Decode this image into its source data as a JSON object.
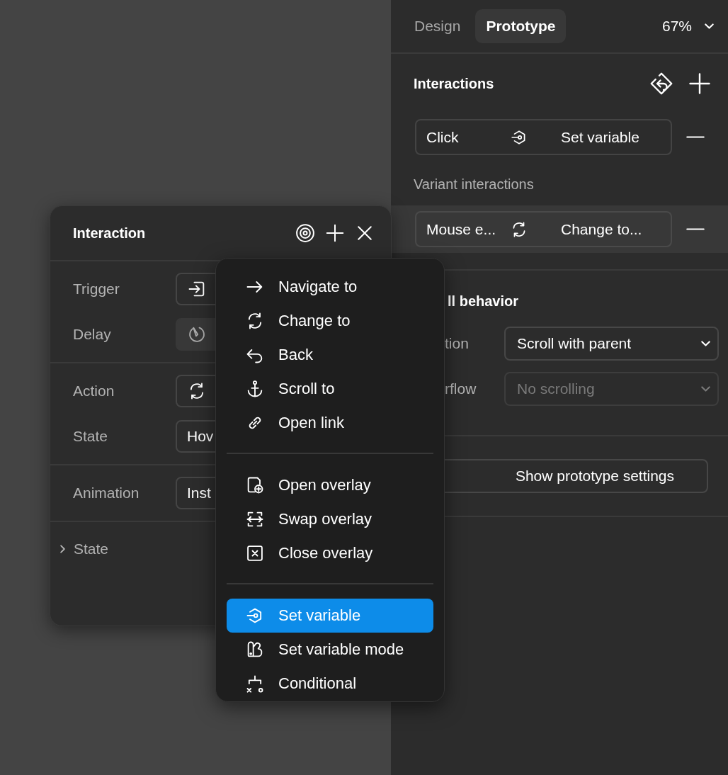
{
  "right_panel": {
    "tabs": [
      {
        "label": "Design",
        "selected": false
      },
      {
        "label": "Prototype",
        "selected": true
      }
    ],
    "zoom": "67%",
    "interactions": {
      "title": "Interactions",
      "rows": [
        {
          "trigger": "Click",
          "action": "Set variable",
          "highlighted": false
        }
      ],
      "variant_title": "Variant interactions",
      "variant_rows": [
        {
          "trigger": "Mouse e...",
          "action": "Change to...",
          "highlighted": true
        }
      ]
    },
    "scroll_behavior": {
      "title": "ll behavior",
      "rows": [
        {
          "label": "tion",
          "value": "Scroll with parent",
          "disabled": false
        },
        {
          "label": "rflow",
          "value": "No scrolling",
          "disabled": true
        }
      ]
    },
    "settings_button": "Show prototype settings"
  },
  "interaction_popup": {
    "title": "Interaction",
    "sections": [
      [
        {
          "label": "Trigger",
          "kind": "select"
        },
        {
          "label": "Delay",
          "kind": "filled"
        }
      ],
      [
        {
          "label": "Action",
          "kind": "select"
        },
        {
          "label": "State",
          "kind": "select",
          "value": "Hov"
        }
      ],
      [
        {
          "label": "Animation",
          "kind": "select",
          "value": "Inst"
        }
      ]
    ],
    "footer": {
      "label": "State",
      "expanded": false
    }
  },
  "action_menu": {
    "groups": [
      [
        {
          "label": "Navigate to",
          "selected": false
        },
        {
          "label": "Change to",
          "selected": false
        },
        {
          "label": "Back",
          "selected": false
        },
        {
          "label": "Scroll to",
          "selected": false
        },
        {
          "label": "Open link",
          "selected": false
        }
      ],
      [
        {
          "label": "Open overlay",
          "selected": false
        },
        {
          "label": "Swap overlay",
          "selected": false
        },
        {
          "label": "Close overlay",
          "selected": false
        }
      ],
      [
        {
          "label": "Set variable",
          "selected": true
        },
        {
          "label": "Set variable mode",
          "selected": false
        },
        {
          "label": "Conditional",
          "selected": false
        }
      ]
    ]
  }
}
